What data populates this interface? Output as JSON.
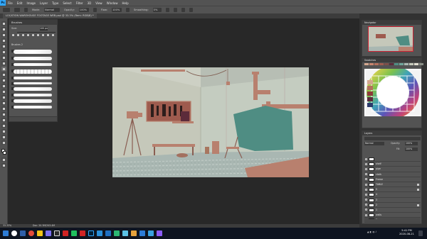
{
  "menubar": {
    "logo": "Ps",
    "items": [
      "File",
      "Edit",
      "Image",
      "Layer",
      "Type",
      "Select",
      "Filter",
      "3D",
      "View",
      "Window",
      "Help"
    ]
  },
  "options": {
    "mode_label": "Mode:",
    "mode_value": "Normal",
    "opacity_label": "Opacity:",
    "opacity_value": "100%",
    "flow_label": "Flow:",
    "flow_value": "100%",
    "smoothing_label": "Smoothing:",
    "smoothing_value": "0%"
  },
  "document": {
    "tab_title": "LOCATION WAREHOUSE FOOTAGE WEB.psd @ 33.3% (Rem: RGB/8) *",
    "zoom": "33.33%",
    "doc_size": "Doc: 20.3M/343.4M"
  },
  "brushes_panel": {
    "title": "Brushes",
    "size_label": "Size:",
    "size_value": "100 px",
    "group_label": "Brushes 2"
  },
  "right_panels": {
    "navigator_title": "Navigator",
    "swatches_title": "Swatches",
    "color_title": "Color",
    "layers_title": "Layers",
    "blend_mode": "Normal",
    "opacity_label": "Opacity:",
    "opacity_value": "100%",
    "fill_label": "Fill:",
    "fill_value": "100%"
  },
  "layers": [
    {
      "name": "",
      "selected": false
    },
    {
      "name": "shelf",
      "selected": false
    },
    {
      "name": "pipe",
      "selected": false
    },
    {
      "name": "cloth",
      "selected": false
    },
    {
      "name": "Frame",
      "selected": false
    },
    {
      "name": "TABLE",
      "selected": false
    },
    {
      "name": "5",
      "selected": false
    },
    {
      "name": "4",
      "selected": false
    },
    {
      "name": "3",
      "selected": false
    },
    {
      "name": "2",
      "selected": false
    },
    {
      "name": "1",
      "selected": false
    },
    {
      "name": "walls",
      "selected": false
    },
    {
      "name": "floor",
      "selected": true
    }
  ],
  "taskbar": {
    "time": "5:41 PM",
    "date": "2020-08-21"
  },
  "colors": {
    "wall_left": "#c5c8ba",
    "wall_right": "#c4ccc0",
    "floor": "#a9b7b2",
    "accent_prop": "#b8806e",
    "teal_cloth": "#4f8d83",
    "photoshop_blue": "#31a8ff"
  }
}
